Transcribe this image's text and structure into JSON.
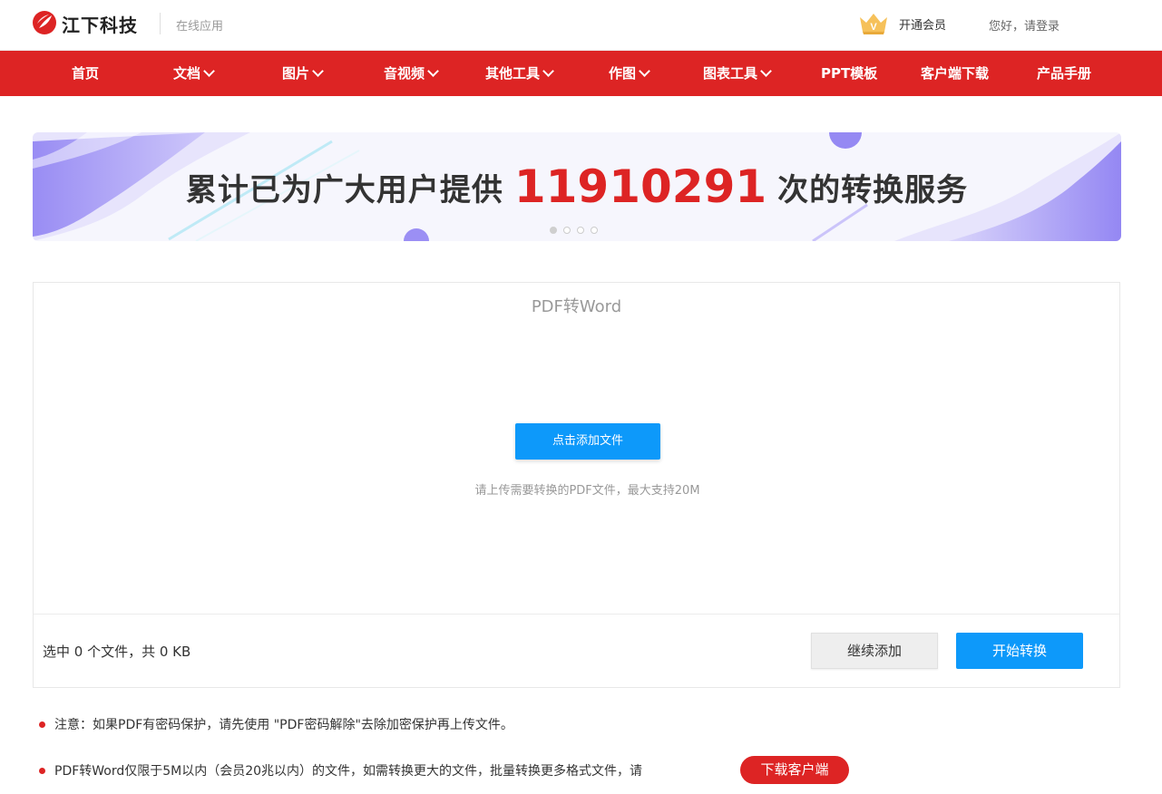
{
  "header": {
    "brand": "江下科技",
    "sub_brand": "在线应用",
    "vip_label": "开通会员",
    "login_label": "您好，请登录"
  },
  "nav": {
    "items": [
      {
        "label": "首页"
      },
      {
        "label": "文档"
      },
      {
        "label": "图片"
      },
      {
        "label": "音视频"
      },
      {
        "label": "其他工具"
      },
      {
        "label": "作图"
      },
      {
        "label": "图表工具"
      },
      {
        "label": "PPT模板"
      },
      {
        "label": "客户端下载"
      },
      {
        "label": "产品手册"
      }
    ]
  },
  "banner": {
    "text_before": "累计已为广大用户提供",
    "count": "11910291",
    "text_after": "次的转换服务",
    "slides": 4,
    "active_slide": 1
  },
  "converter": {
    "title": "PDF转Word",
    "add_file_label": "点击添加文件",
    "hint": "请上传需要转换的PDF文件，最大支持20M",
    "selected_info": "选中 0 个文件，共 0 KB",
    "continue_label": "继续添加",
    "start_label": "开始转换"
  },
  "notes": {
    "note1": "注意：如果PDF有密码保护，请先使用 \"PDF密码解除\"去除加密保护再上传文件。",
    "note2": "PDF转Word仅限于5M以内（会员20兆以内）的文件，如需转换更大的文件，批量转换更多格式文件，请",
    "download_label": "下载客户端"
  },
  "colors": {
    "brand_red": "#dd2424",
    "primary_blue": "#0d99fa",
    "banner_purple": "#8a7cf0"
  }
}
